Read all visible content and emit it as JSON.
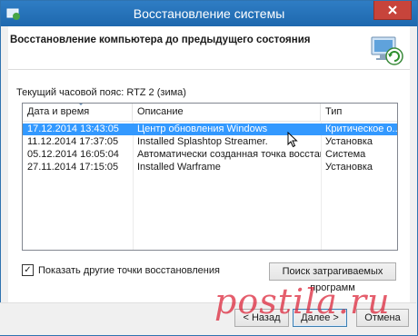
{
  "window": {
    "title": "Восстановление системы",
    "heading": "Восстановление компьютера до предыдущего состояния"
  },
  "timezone_text": "Текущий часовой пояс: RTZ 2 (зима)",
  "table": {
    "columns": [
      "Дата и время",
      "Описание",
      "Тип"
    ],
    "rows": [
      {
        "date": "17.12.2014 13:43:05",
        "description": "Центр обновления Windows",
        "type": "Критическое о...",
        "selected": true
      },
      {
        "date": "11.12.2014 17:37:05",
        "description": "Installed Splashtop Streamer.",
        "type": "Установка"
      },
      {
        "date": "05.12.2014 16:05:04",
        "description": "Автоматически созданная точка восстанов...",
        "type": "Система"
      },
      {
        "date": "27.11.2014 17:15:05",
        "description": "Installed Warframe",
        "type": "Установка"
      }
    ]
  },
  "show_more": {
    "label": "Показать другие точки восстановления",
    "checked": true
  },
  "buttons": {
    "scan": "Поиск затрагиваемых программ",
    "back": "< Назад",
    "next": "Далее >",
    "cancel": "Отмена"
  },
  "watermark": "postila.ru",
  "colors": {
    "titlebar": "#1e68ae",
    "selection": "#3399ff",
    "watermark": "#dc283c"
  }
}
